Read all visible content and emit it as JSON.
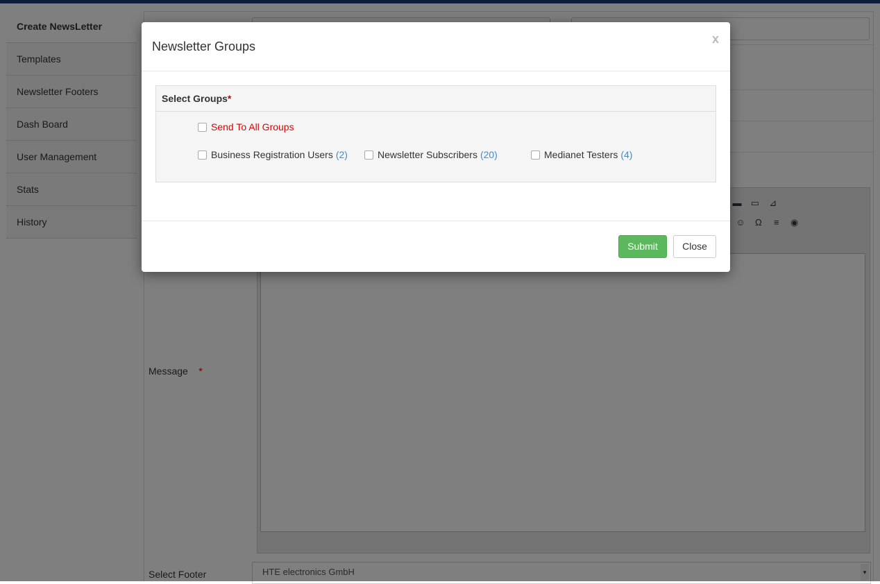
{
  "sidebar": {
    "items": [
      {
        "label": "Create NewsLetter"
      },
      {
        "label": "Templates"
      },
      {
        "label": "Newsletter Footers"
      },
      {
        "label": "Dash Board"
      },
      {
        "label": "User Management"
      },
      {
        "label": "Stats"
      },
      {
        "label": "History"
      }
    ]
  },
  "form": {
    "message_label": "Message",
    "required_mark": "*",
    "footer_label": "Select Footer",
    "footer_value": "HTE electronics GmbH"
  },
  "modal": {
    "title": "Newsletter Groups",
    "close_x": "x",
    "panel_title": "Select Groups",
    "required_mark": "*",
    "send_all_label": "Send To All Groups",
    "groups": [
      {
        "label": "Business Registration Users",
        "count": "(2)"
      },
      {
        "label": "Newsletter Subscribers",
        "count": "(20)"
      },
      {
        "label": "Medianet Testers",
        "count": "(4)"
      }
    ],
    "submit_label": "Submit",
    "close_label": "Close"
  },
  "colors": {
    "topbar": "#1f3a78",
    "submit": "#5cb85c",
    "required": "#c00000",
    "count": "#428bca"
  }
}
